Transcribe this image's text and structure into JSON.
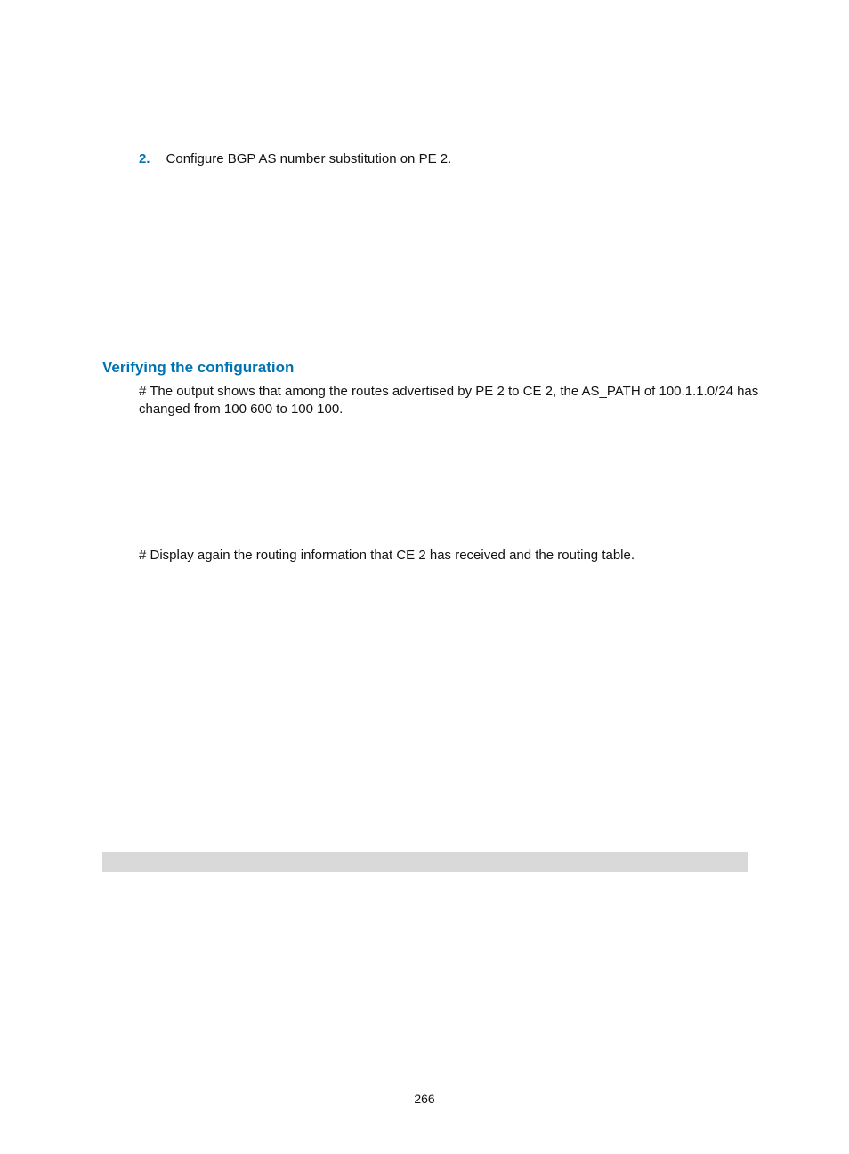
{
  "step": {
    "number": "2.",
    "text": "Configure BGP AS number substitution on PE 2."
  },
  "section": {
    "heading": "Verifying the configuration",
    "para1": "# The output shows that among the routes advertised by PE 2 to CE 2, the AS_PATH of 100.1.1.0/24 has changed from 100 600 to 100 100.",
    "para2": "# Display again the routing information that CE 2 has received and the routing table."
  },
  "pageNumber": "266"
}
